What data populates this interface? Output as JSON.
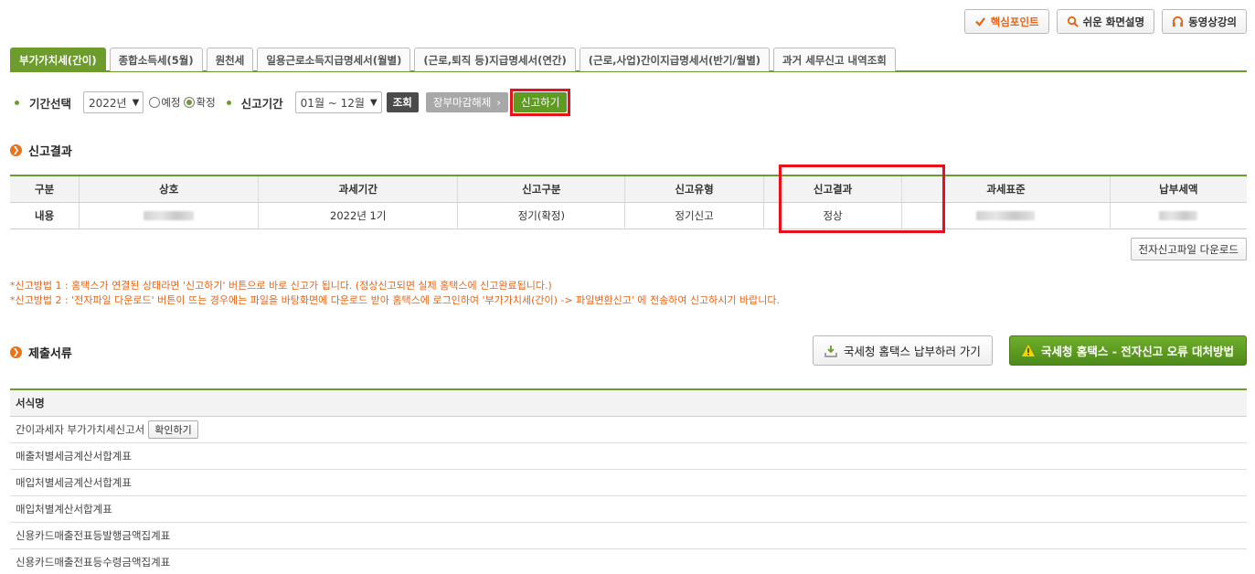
{
  "top_buttons": {
    "core_point": "핵심포인트",
    "easy_guide": "쉬운 화면설명",
    "video_lecture": "동영상강의"
  },
  "tabs": [
    {
      "label": "부가가치세(간이)",
      "active": true
    },
    {
      "label": "종합소득세(5월)",
      "active": false
    },
    {
      "label": "원천세",
      "active": false
    },
    {
      "label": "일용근로소득지급명세서(월별)",
      "active": false
    },
    {
      "label": "(근로,퇴직 등)지급명세서(연간)",
      "active": false
    },
    {
      "label": "(근로,사업)간이지급명세서(반기/월별)",
      "active": false
    },
    {
      "label": "과거 세무신고 내역조회",
      "active": false
    }
  ],
  "filter": {
    "period_select_label": "기간선택",
    "year_value": "2022년",
    "radio_expected": "예정",
    "radio_confirmed": "확정",
    "report_period_label": "신고기간",
    "month_range_value": "01월 ~ 12월",
    "search_button": "조회",
    "ledger_release_button": "장부마감해제",
    "file_report_button": "신고하기"
  },
  "result_section": {
    "title": "신고결과",
    "headers": [
      "구분",
      "상호",
      "과세기간",
      "신고구분",
      "신고유형",
      "신고결과",
      "과세표준",
      "납부세액"
    ],
    "row": [
      "내용",
      "",
      "2022년 1기",
      "정기(확정)",
      "정기신고",
      "정상",
      "",
      ""
    ],
    "download_button": "전자신고파일 다운로드"
  },
  "notes": [
    "*신고방법 1 : 홈택스가 연결된 상태라면 '신고하기' 버튼으로 바로 신고가 됩니다. (정상신고되면 실제 홈택스에 신고완료됩니다.)",
    "*신고방법 2 : '전자파일 다운로드' 버튼이 뜨는 경우에는 파일을 바탕화면에 다운로드 받아 홈택스에 로그인하여 '부가가치세(간이) -> 파일변환신고' 에 전송하여 신고하시기 바랍니다."
  ],
  "documents_section": {
    "title": "제출서류",
    "hometax_payment_button": "국세청 홈택스 납부하러 가기",
    "error_fix_button": "국세청 홈택스 - 전자신고 오류 대처방법",
    "header": "서식명",
    "rows": [
      {
        "name": "간이과세자 부가가치세신고서",
        "button": "확인하기"
      },
      {
        "name": "매출처별세금계산서합계표"
      },
      {
        "name": "매입처별세금계산서합계표"
      },
      {
        "name": "매입처별계산서합계표"
      },
      {
        "name": "신용카드매출전표등발행금액집계표"
      },
      {
        "name": "신용카드매출전표등수령금액집계표"
      }
    ]
  },
  "colors": {
    "accent_green": "#6d9b2c",
    "highlight_red": "#e8101b",
    "note_orange": "#e2661b"
  }
}
